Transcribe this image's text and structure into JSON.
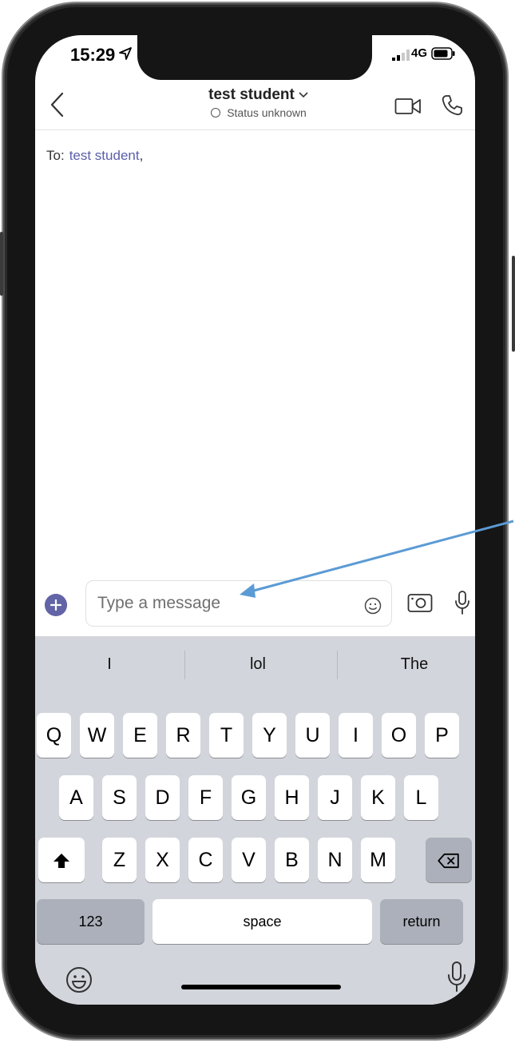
{
  "status_bar": {
    "time": "15:29",
    "network": "4G"
  },
  "chat_header": {
    "title": "test student",
    "status": "Status unknown"
  },
  "recipients": {
    "label": "To:",
    "names": "test student",
    "separator": ","
  },
  "composer": {
    "placeholder": "Type a message"
  },
  "keyboard": {
    "suggestions": [
      "I",
      "lol",
      "The"
    ],
    "row1": [
      "Q",
      "W",
      "E",
      "R",
      "T",
      "Y",
      "U",
      "I",
      "O",
      "P"
    ],
    "row2": [
      "A",
      "S",
      "D",
      "F",
      "G",
      "H",
      "J",
      "K",
      "L"
    ],
    "row3": [
      "Z",
      "X",
      "C",
      "V",
      "B",
      "N",
      "M"
    ],
    "numbers_label": "123",
    "space_label": "space",
    "return_label": "return"
  },
  "colors": {
    "accent": "#6264a7",
    "annotation_arrow": "#5b9bd5",
    "keyboard_bg": "#d2d5db"
  }
}
